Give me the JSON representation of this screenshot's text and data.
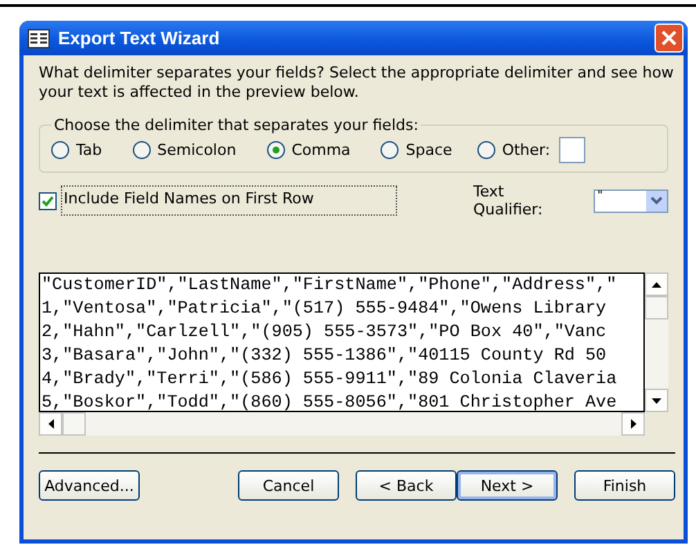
{
  "window": {
    "title": "Export Text Wizard"
  },
  "instruction": "What delimiter separates your fields? Select the appropriate delimiter and see how your text is affected in the preview below.",
  "delimiter_group": {
    "legend": "Choose the delimiter that separates your fields:",
    "options": [
      {
        "label": "Tab",
        "selected": false
      },
      {
        "label": "Semicolon",
        "selected": false
      },
      {
        "label": "Comma",
        "selected": true
      },
      {
        "label": "Space",
        "selected": false
      },
      {
        "label": "Other:",
        "selected": false
      }
    ]
  },
  "include_field_names": {
    "label": "Include Field Names on First Row",
    "checked": true
  },
  "text_qualifier": {
    "label": "Text Qualifier:",
    "value": "\""
  },
  "preview": {
    "rows": [
      "\"CustomerID\",\"LastName\",\"FirstName\",\"Phone\",\"Address\",\"",
      "1,\"Ventosa\",\"Patricia\",\"(517) 555-9484\",\"Owens Library",
      "2,\"Hahn\",\"Carlzell\",\"(905) 555-3573\",\"PO Box 40\",\"Vanc",
      "3,\"Basara\",\"John\",\"(332) 555-1386\",\"40115 County Rd 50",
      "4,\"Brady\",\"Terri\",\"(586) 555-9911\",\"89 Colonia Claveria",
      "5,\"Boskor\",\"Todd\",\"(860) 555-8056\",\"801 Christopher Ave"
    ]
  },
  "buttons": [
    {
      "label": "Advanced...",
      "kind": "left"
    },
    {
      "label": "Cancel",
      "kind": "right"
    },
    {
      "label": "< Back",
      "kind": "right"
    },
    {
      "label": "Next >",
      "kind": "default"
    },
    {
      "label": "Finish",
      "kind": "right"
    }
  ]
}
